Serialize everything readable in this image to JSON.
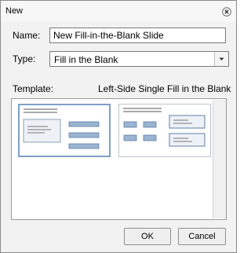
{
  "window": {
    "title": "New"
  },
  "name_field": {
    "label": "Name:",
    "value": "New Fill-in-the-Blank Slide"
  },
  "type_field": {
    "label": "Type:",
    "selected": "Fill in the Blank"
  },
  "template": {
    "label": "Template:",
    "selected_name": "Left-Side Single Fill in the Blank",
    "items": [
      {
        "selected": true
      },
      {
        "selected": false
      }
    ]
  },
  "buttons": {
    "ok": "OK",
    "cancel": "Cancel"
  },
  "colors": {
    "accent": "#7ea0c8",
    "shape_fill": "#9ab4d2",
    "shape_stroke": "#5f7fa6"
  },
  "icons": {
    "close": "close-icon",
    "dropdown": "chevron-down-icon"
  }
}
